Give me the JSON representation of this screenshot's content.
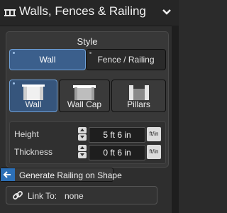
{
  "header": {
    "title": "Walls, Fences & Railing",
    "icon": "railing-icon",
    "collapse_icon": "chevron-down-icon"
  },
  "style_group": {
    "title": "Style",
    "segments": [
      {
        "label": "Wall",
        "selected": true
      },
      {
        "label": "Fence / Railing",
        "selected": false
      }
    ]
  },
  "type_tiles": [
    {
      "label": "Wall",
      "icon": "wall-icon",
      "selected": true
    },
    {
      "label": "Wall Cap",
      "icon": "wall-cap-icon",
      "selected": false
    },
    {
      "label": "Pillars",
      "icon": "pillars-icon",
      "selected": false
    }
  ],
  "dimensions": {
    "height": {
      "label": "Height",
      "value": "5 ft  6 in",
      "unit": "ft/in"
    },
    "thickness": {
      "label": "Thickness",
      "value": "0 ft  6 in",
      "unit": "ft/in"
    }
  },
  "generate_button": {
    "label": "Generate Railing on Shape",
    "icon": "arrow-left-icon"
  },
  "link": {
    "label": "Link To:",
    "value": "none",
    "icon": "link-icon"
  },
  "colors": {
    "accent": "#3b5f8c",
    "accent_border": "#6e9fd6",
    "button_blue": "#2c6fb6"
  }
}
